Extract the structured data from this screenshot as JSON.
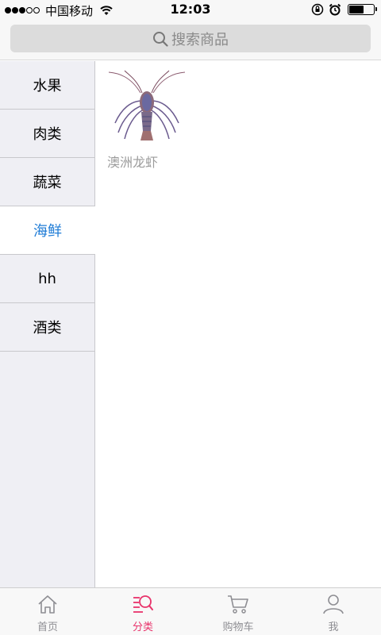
{
  "status_bar": {
    "carrier": "中国移动",
    "time": "12:03",
    "signal_bars_filled": 3,
    "signal_bars_total": 5,
    "battery_level": 0.55
  },
  "search": {
    "placeholder": "搜索商品",
    "icon": "search-icon"
  },
  "sidebar": {
    "items": [
      {
        "label": "水果",
        "active": false
      },
      {
        "label": "肉类",
        "active": false
      },
      {
        "label": "蔬菜",
        "active": false
      },
      {
        "label": "海鲜",
        "active": true
      },
      {
        "label": "hh",
        "active": false
      },
      {
        "label": "酒类",
        "active": false
      }
    ],
    "active_color": "#1e7bd6"
  },
  "products": [
    {
      "name": "澳洲龙虾",
      "image": "lobster-image"
    }
  ],
  "tabs": [
    {
      "label": "首页",
      "icon": "home-icon",
      "active": false
    },
    {
      "label": "分类",
      "icon": "category-icon",
      "active": true
    },
    {
      "label": "购物车",
      "icon": "cart-icon",
      "active": false
    },
    {
      "label": "我",
      "icon": "user-icon",
      "active": false
    }
  ],
  "colors": {
    "tab_active": "#e8336b",
    "tab_inactive": "#8e8e93"
  }
}
